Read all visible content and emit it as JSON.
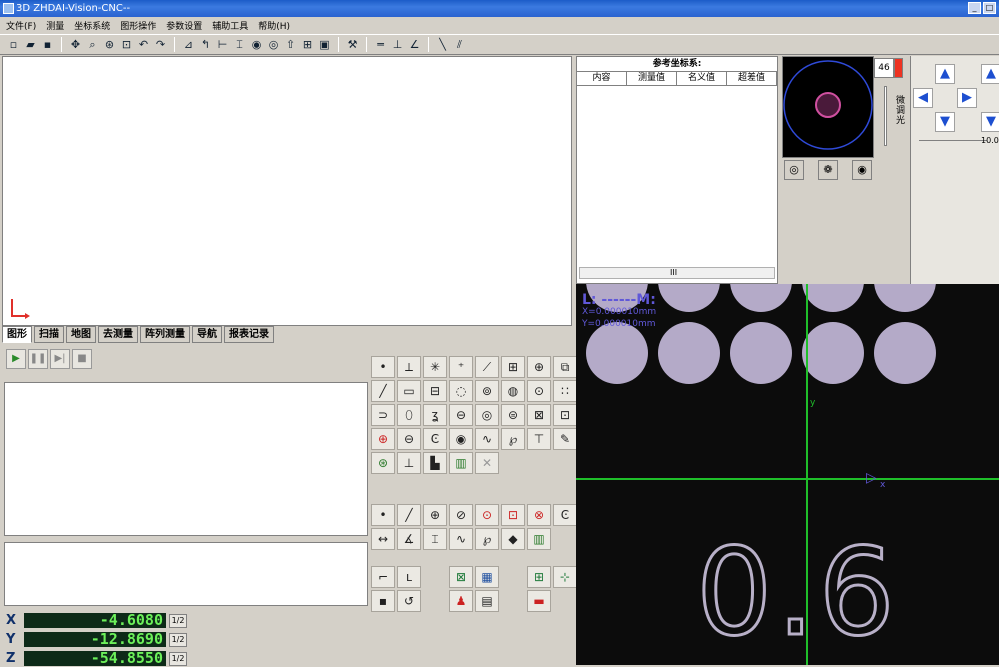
{
  "window": {
    "title": "3D ZHDAI-Vision-CNC--"
  },
  "menu": [
    "文件(F)",
    "测量",
    "坐标系统",
    "图形操作",
    "参数设置",
    "辅助工具",
    "帮助(H)"
  ],
  "tabs": [
    "图形",
    "扫描",
    "地图",
    "去测量",
    "阵列测量",
    "导航",
    "报表记录"
  ],
  "measure_panel": {
    "title": "参考坐标系:",
    "columns": [
      "内容",
      "测量值",
      "名义值",
      "超差值"
    ],
    "scroll_label": "III"
  },
  "coords": [
    {
      "axis": "X",
      "value": "-4.6080",
      "half": "1/2"
    },
    {
      "axis": "Y",
      "value": "-12.8690",
      "half": "1/2"
    },
    {
      "axis": "Z",
      "value": "-54.8550",
      "half": "1/2"
    }
  ],
  "slider": {
    "value": "46",
    "label": "微调光",
    "range_label": "10.0"
  },
  "camera": {
    "overlay_line1": "L: ------M:",
    "overlay_x": "X=0.000010mm",
    "overlay_y": "Y=0.000010mm",
    "axis_y_label": "y",
    "axis_x_label": "x",
    "big_text": "0.6",
    "crosshair_color": "#1fbf2a"
  },
  "icons": {
    "toolbar": [
      "new-file-icon",
      "open-icon",
      "save-icon",
      "move-icon",
      "zoom-window-icon",
      "zoom-fit-icon",
      "undo-icon",
      "redo-icon",
      "measure-angle-icon",
      "distance-icon",
      "width-icon",
      "circle-icon",
      "center-icon",
      "top-icon",
      "frame-icon",
      "box-icon",
      "tool-icon",
      "parallel-icon",
      "perpendicular-icon",
      "angle-icon",
      "line-icon",
      "split-icon"
    ]
  }
}
